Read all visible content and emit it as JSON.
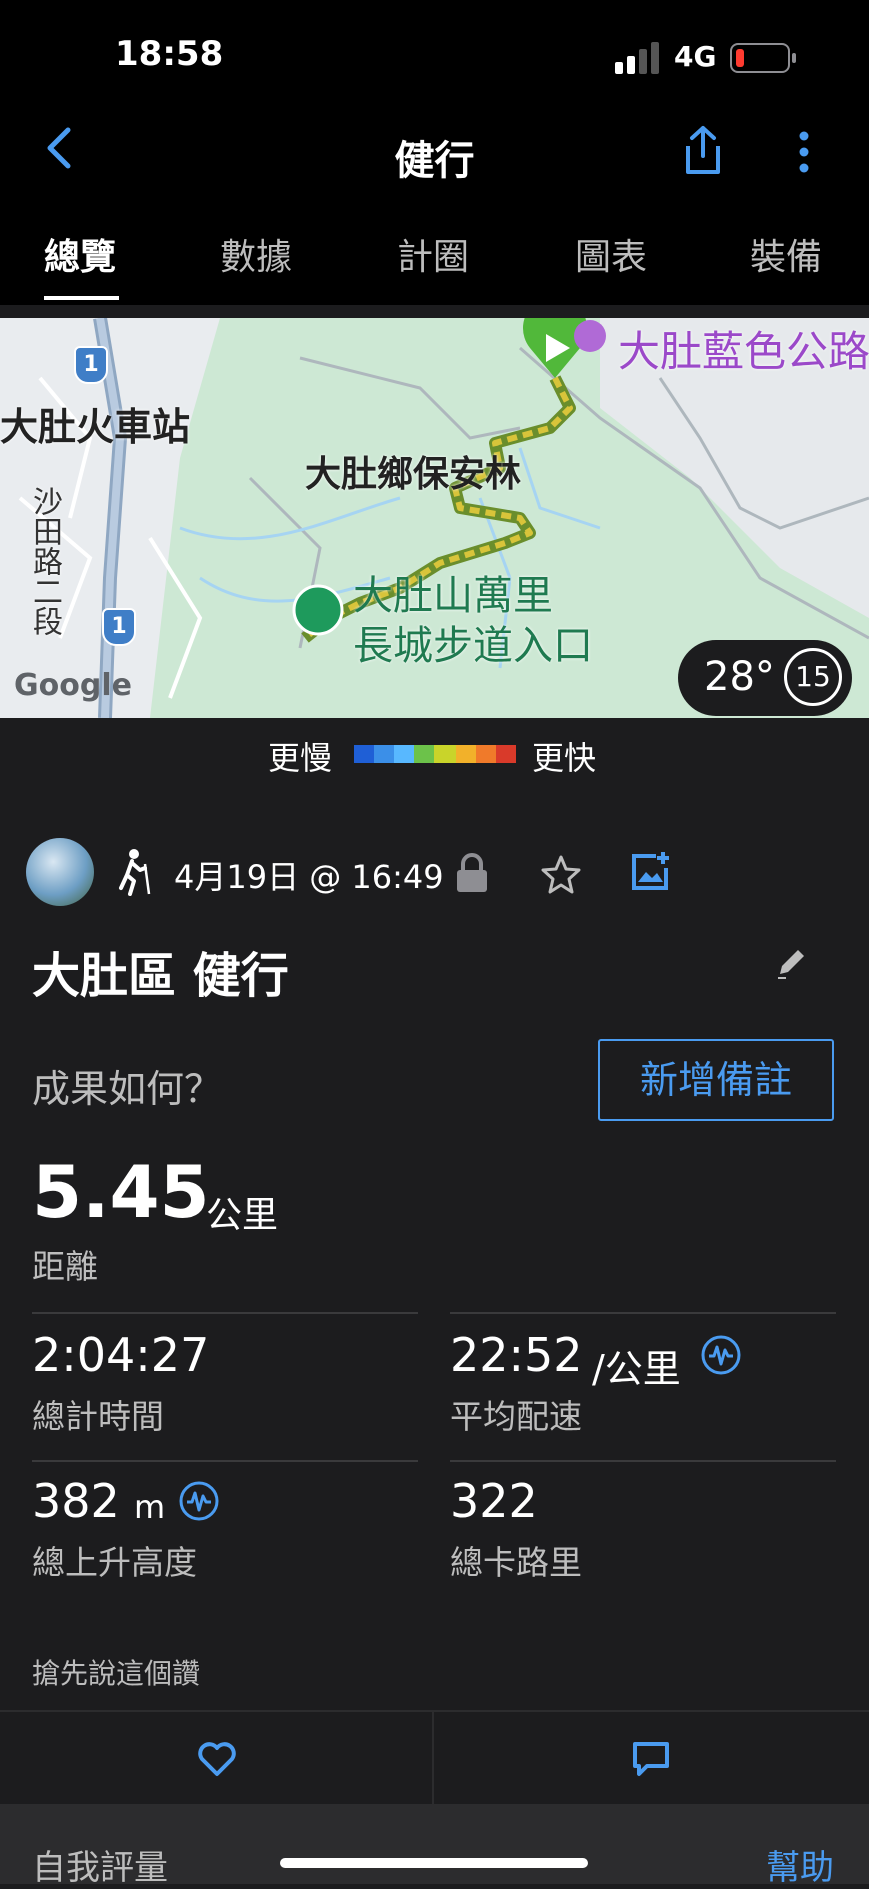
{
  "status": {
    "time": "18:58",
    "network": "4G"
  },
  "nav": {
    "title": "健行"
  },
  "tabs": [
    "總覽",
    "數據",
    "計圈",
    "圖表",
    "裝備"
  ],
  "map": {
    "labels": {
      "station": "大肚火車站",
      "forest": "大肚鄉保安林",
      "trail_line1": "大肚山萬里",
      "trail_line2": "長城步道入口",
      "road": "沙田路二段",
      "park": "大肚藍色公路",
      "route_marker": "1",
      "google": "Google"
    },
    "weather": {
      "temp": "28°",
      "wind": "15"
    }
  },
  "legend": {
    "slow": "更慢",
    "fast": "更快",
    "colors": [
      "#1f5fd6",
      "#3b8fe8",
      "#58b8ff",
      "#6cc24a",
      "#c9d42a",
      "#f2b12a",
      "#f07a2a",
      "#d93a2a"
    ]
  },
  "activity": {
    "datetime": "4月19日 @ 16:49",
    "title": "大肚區 健行",
    "prompt": "成果如何？",
    "add_note": "新增備註",
    "distance_value": "5.45",
    "distance_unit": "公里",
    "distance_label": "距離",
    "stats": [
      {
        "value": "2:04:27",
        "unit": "",
        "label": "總計時間"
      },
      {
        "value": "22:52",
        "unit": "/公里",
        "label": "平均配速"
      },
      {
        "value": "382",
        "unit": "m",
        "label": "總上升高度"
      },
      {
        "value": "322",
        "unit": "",
        "label": "總卡路里"
      }
    ],
    "like_prompt": "搶先說這個讚"
  },
  "footer": {
    "self_eval": "自我評量",
    "help": "幫助"
  }
}
